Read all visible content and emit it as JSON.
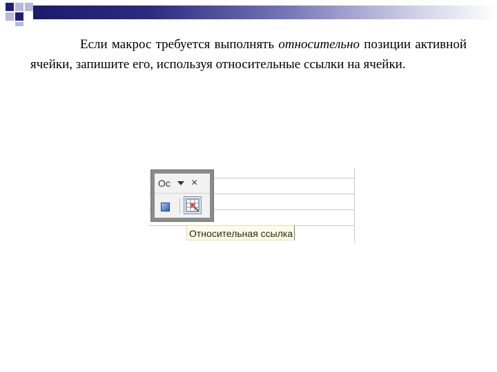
{
  "slide": {
    "paragraph": {
      "part1": "Если макрос требуется выполнять ",
      "emphasis": "относительно",
      "part2": " позиции активной ячейки, запишите его, используя относительные ссылки на ячейки."
    }
  },
  "screenshot": {
    "toolbar": {
      "title": "Ос",
      "dropdown_icon": "chevron-down-icon",
      "close_label": "×",
      "buttons": [
        {
          "name": "stop-recording",
          "icon": "stop-square-icon"
        },
        {
          "name": "relative-reference",
          "icon": "relative-reference-icon",
          "state": "hovered"
        }
      ]
    },
    "tooltip": "Относительная ссылка"
  },
  "colors": {
    "header_dark": "#1f1f78",
    "header_light": "#b7b7e0",
    "tooltip_bg": "#fffde6"
  }
}
